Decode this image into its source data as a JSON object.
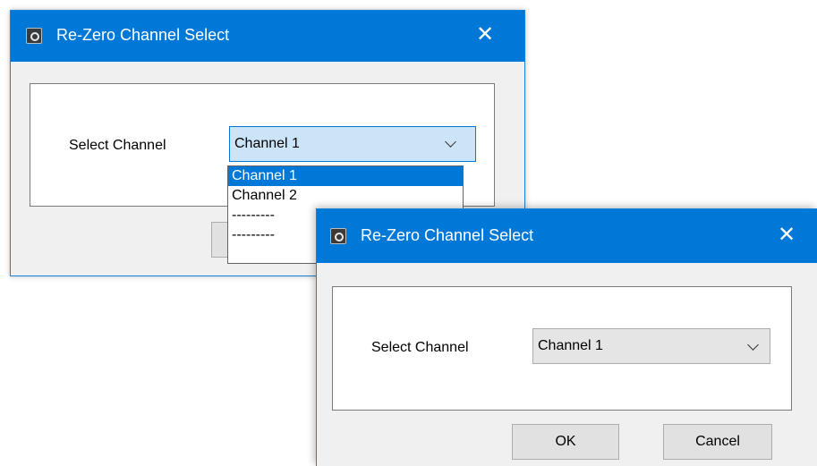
{
  "back_dialog": {
    "title": "Re-Zero Channel Select",
    "close_glyph": "✕",
    "field_label": "Select Channel",
    "combo_value": "Channel 1",
    "dropdown_items": [
      "Channel 1",
      "Channel 2",
      "---------",
      "---------"
    ],
    "selected_index": 0
  },
  "front_dialog": {
    "title": "Re-Zero Channel Select",
    "close_glyph": "✕",
    "field_label": "Select Channel",
    "combo_value": "Channel 1",
    "ok_label": "OK",
    "cancel_label": "Cancel"
  },
  "colors": {
    "titlebar": "#0078d7",
    "selection": "#0078d7",
    "dialog_background": "#f0f0f0"
  },
  "icons": {
    "app": "app-icon",
    "close": "close-icon",
    "dropdown": "chevron-down-icon"
  }
}
